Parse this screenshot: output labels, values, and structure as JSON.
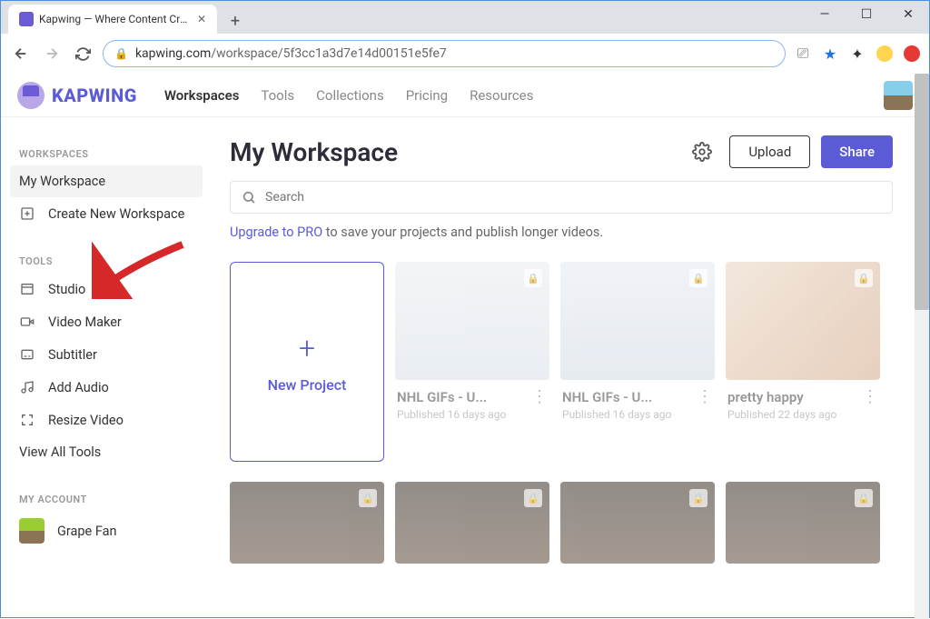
{
  "browser": {
    "tab_title": "Kapwing — Where Content Crea",
    "url_domain": "kapwing.com",
    "url_path": "/workspace/5f3cc1a3d7e14d00151e5fe7"
  },
  "app": {
    "brand": "KAPWING",
    "nav": [
      "Workspaces",
      "Tools",
      "Collections",
      "Pricing",
      "Resources"
    ]
  },
  "sidebar": {
    "workspaces_heading": "WORKSPACES",
    "my_workspace": "My Workspace",
    "create_workspace": "Create New Workspace",
    "tools_heading": "TOOLS",
    "tools": [
      {
        "icon": "layout-icon",
        "label": "Studio"
      },
      {
        "icon": "video-icon",
        "label": "Video Maker"
      },
      {
        "icon": "subtitle-icon",
        "label": "Subtitler"
      },
      {
        "icon": "music-icon",
        "label": "Add Audio"
      },
      {
        "icon": "resize-icon",
        "label": "Resize Video"
      }
    ],
    "view_all": "View All Tools",
    "account_heading": "MY ACCOUNT",
    "account_name": "Grape Fan"
  },
  "main": {
    "title": "My Workspace",
    "upload": "Upload",
    "share": "Share",
    "search_placeholder": "Search",
    "upgrade_link": "Upgrade to PRO",
    "upgrade_rest": " to save your projects and publish longer videos.",
    "new_project": "New Project",
    "projects": [
      {
        "title": "NHL GIFs - U...",
        "meta": "Published 16 days ago",
        "thumb": "hockey1"
      },
      {
        "title": "NHL GIFs - U...",
        "meta": "Published 16 days ago",
        "thumb": "hockey2"
      },
      {
        "title": "pretty happy",
        "meta": "Published 22 days ago",
        "thumb": "happy"
      }
    ]
  }
}
